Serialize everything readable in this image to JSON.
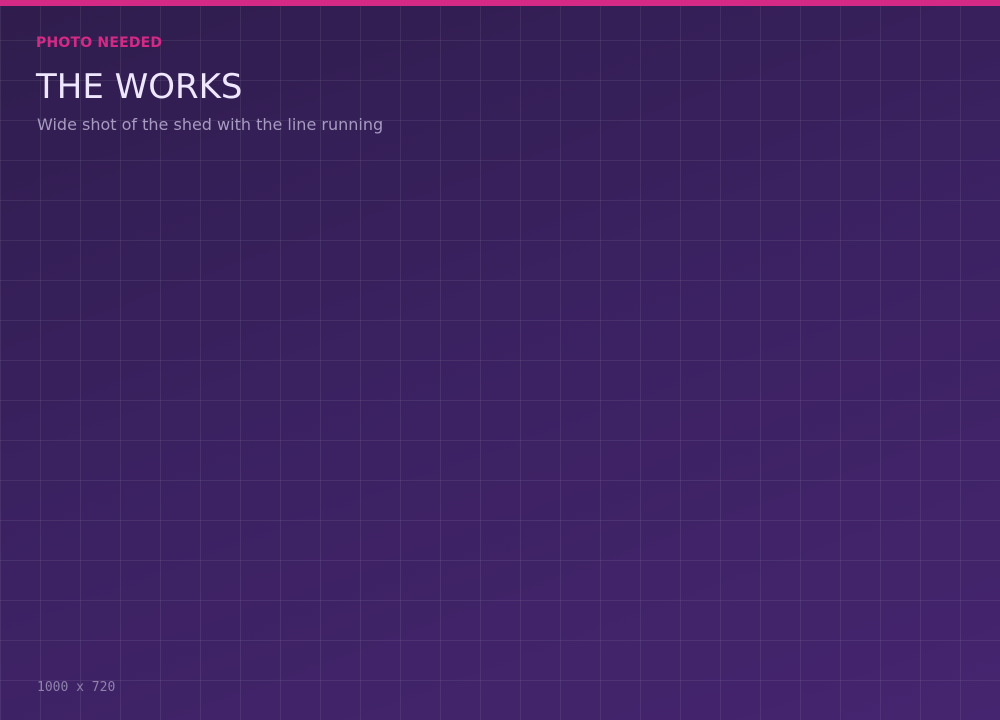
{
  "placeholder": {
    "label": "PHOTO NEEDED",
    "title": "THE WORKS",
    "description": "Wide shot of the shed with the line running",
    "dimensions": "1000 x 720"
  },
  "colors": {
    "accent": "#d42a86",
    "background_start": "#2f1d4d",
    "background_end": "#45256f",
    "title_text": "#efe6ff",
    "subtitle_text": "#a79bc2"
  }
}
